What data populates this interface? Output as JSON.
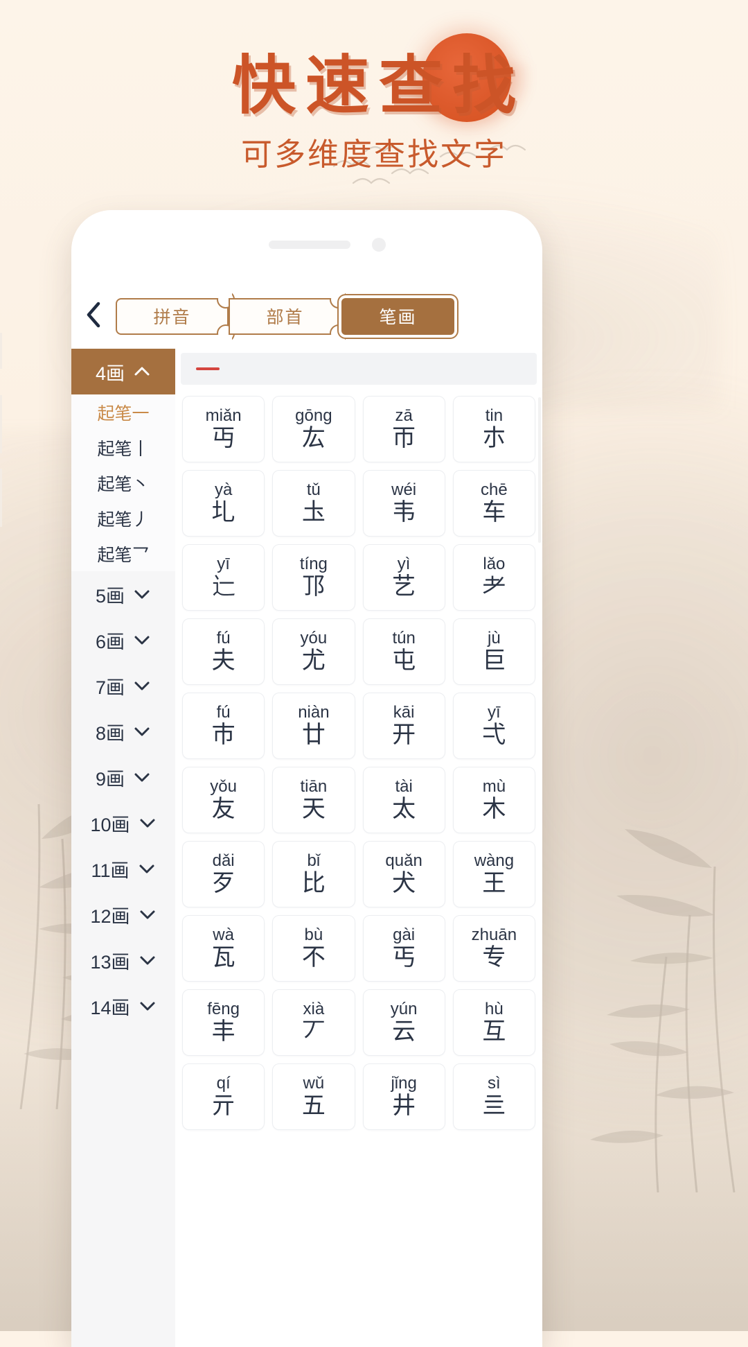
{
  "hero": {
    "title": "快速查找",
    "subtitle": "可多维度查找文字"
  },
  "colors": {
    "accent_orange": "#cc5427",
    "brand_brown": "#a5703f",
    "tab_border": "#b07c4a",
    "active_sub": "#c98a48",
    "dash_red": "#d4453f",
    "text_dark": "#2b3445",
    "page_bg": "#fdf3e7"
  },
  "phone": {
    "nav": {
      "back_icon": "chevron-left-icon",
      "tabs": [
        {
          "label": "拼音",
          "active": false
        },
        {
          "label": "部首",
          "active": false
        },
        {
          "label": "笔画",
          "active": true
        }
      ]
    },
    "sidebar": {
      "groups": [
        {
          "label": "4画",
          "expanded": true,
          "chevron": "chevron-up-icon",
          "items": [
            {
              "label": "起笔一",
              "active": true
            },
            {
              "label": "起笔丨",
              "active": false
            },
            {
              "label": "起笔丶",
              "active": false
            },
            {
              "label": "起笔丿",
              "active": false
            },
            {
              "label": "起笔乛",
              "active": false
            }
          ]
        },
        {
          "label": "5画",
          "expanded": false,
          "chevron": "chevron-down-icon",
          "items": []
        },
        {
          "label": "6画",
          "expanded": false,
          "chevron": "chevron-down-icon",
          "items": []
        },
        {
          "label": "7画",
          "expanded": false,
          "chevron": "chevron-down-icon",
          "items": []
        },
        {
          "label": "8画",
          "expanded": false,
          "chevron": "chevron-down-icon",
          "items": []
        },
        {
          "label": "9画",
          "expanded": false,
          "chevron": "chevron-down-icon",
          "items": []
        },
        {
          "label": "10画",
          "expanded": false,
          "chevron": "chevron-down-icon",
          "items": []
        },
        {
          "label": "11画",
          "expanded": false,
          "chevron": "chevron-down-icon",
          "items": []
        },
        {
          "label": "12画",
          "expanded": false,
          "chevron": "chevron-down-icon",
          "items": []
        },
        {
          "label": "13画",
          "expanded": false,
          "chevron": "chevron-down-icon",
          "items": []
        },
        {
          "label": "14画",
          "expanded": false,
          "chevron": "chevron-down-icon",
          "items": []
        }
      ]
    },
    "section_header": {
      "stroke_label": "一"
    },
    "grid": {
      "columns": 4,
      "cells": [
        {
          "pinyin": "miǎn",
          "char": "丏"
        },
        {
          "pinyin": "gōng",
          "char": "厷"
        },
        {
          "pinyin": "zā",
          "char": "帀"
        },
        {
          "pinyin": "tin",
          "char": "朩"
        },
        {
          "pinyin": "yà",
          "char": "圠"
        },
        {
          "pinyin": "tǔ",
          "char": "圡"
        },
        {
          "pinyin": "wéi",
          "char": "韦"
        },
        {
          "pinyin": "chē",
          "char": "车"
        },
        {
          "pinyin": "yī",
          "char": "辷"
        },
        {
          "pinyin": "tíng",
          "char": "邒"
        },
        {
          "pinyin": "yì",
          "char": "艺"
        },
        {
          "pinyin": "lǎo",
          "char": "耂"
        },
        {
          "pinyin": "fú",
          "char": "夫"
        },
        {
          "pinyin": "yóu",
          "char": "尤"
        },
        {
          "pinyin": "tún",
          "char": "屯"
        },
        {
          "pinyin": "jù",
          "char": "巨"
        },
        {
          "pinyin": "fú",
          "char": "巿"
        },
        {
          "pinyin": "niàn",
          "char": "廿"
        },
        {
          "pinyin": "kāi",
          "char": "开"
        },
        {
          "pinyin": "yī",
          "char": "弌"
        },
        {
          "pinyin": "yǒu",
          "char": "友"
        },
        {
          "pinyin": "tiān",
          "char": "天"
        },
        {
          "pinyin": "tài",
          "char": "太"
        },
        {
          "pinyin": "mù",
          "char": "木"
        },
        {
          "pinyin": "dǎi",
          "char": "歹"
        },
        {
          "pinyin": "bǐ",
          "char": "比"
        },
        {
          "pinyin": "quǎn",
          "char": "犬"
        },
        {
          "pinyin": "wàng",
          "char": "王"
        },
        {
          "pinyin": "wà",
          "char": "瓦"
        },
        {
          "pinyin": "bù",
          "char": "不"
        },
        {
          "pinyin": "gài",
          "char": "丐"
        },
        {
          "pinyin": "zhuān",
          "char": "专"
        },
        {
          "pinyin": "fēng",
          "char": "丰"
        },
        {
          "pinyin": "xià",
          "char": "丆"
        },
        {
          "pinyin": "yún",
          "char": "云"
        },
        {
          "pinyin": "hù",
          "char": "互"
        },
        {
          "pinyin": "qí",
          "char": "亓"
        },
        {
          "pinyin": "wǔ",
          "char": "五"
        },
        {
          "pinyin": "jǐng",
          "char": "井"
        },
        {
          "pinyin": "sì",
          "char": "亖"
        }
      ]
    }
  }
}
